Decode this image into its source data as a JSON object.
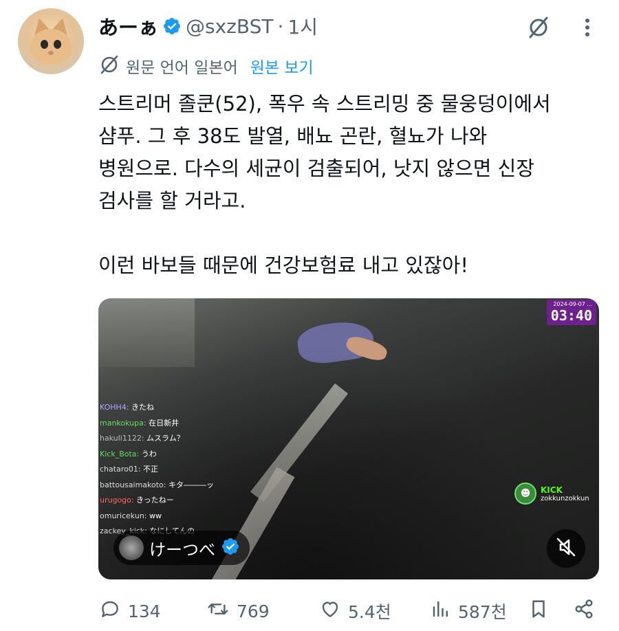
{
  "tweet": {
    "author": {
      "name": "あーぁ",
      "handle": "@sxzBST",
      "separator": "·",
      "time": "1시",
      "verified": true
    },
    "translation": {
      "label": "원문 언어 일본어",
      "show_original": "원본 보기"
    },
    "text_lines": [
      "스트리머 졸쿤(52), 폭우 속 스트리밍 중 물웅덩이에서",
      "샴푸. 그 후 38도 발열, 배뇨 곤란, 혈뇨가 나와",
      "병원으로. 다수의 세균이 검출되어, 낫지 않으면 신장",
      "검사를 할 거라고.",
      "",
      "이런 바보들 때문에 건강보험료 내고 있잖아!"
    ],
    "media": {
      "timestamp_date": "2024-09-07 ...",
      "timestamp": "03:40",
      "chat": [
        {
          "user": "KOHH4",
          "color": "#a9a9ff",
          "message": "きたね"
        },
        {
          "user": "mankokupa",
          "color": "#66dd66",
          "message": "在日新井"
        },
        {
          "user": "hakuli1122",
          "color": "#bbbbbb",
          "message": "ムスラム？"
        },
        {
          "user": "Kick_Bota",
          "color": "#66dd66",
          "message": "うわ"
        },
        {
          "user": "chataro01",
          "color": "#dddddd",
          "message": "不正"
        },
        {
          "user": "battousaimakoto",
          "color": "#dddddd",
          "message": "キタ―――ッ"
        },
        {
          "user": "urugogo",
          "color": "#ff6666",
          "message": "きったねー"
        },
        {
          "user": "omuricekun",
          "color": "#dddddd",
          "message": "ww"
        },
        {
          "user": "zackey_kick",
          "color": "#dddddd",
          "message": "なにしてんの"
        }
      ],
      "kick_brand": "KICK",
      "kick_user": "zokkunzokkun",
      "creator_name": "けーつべ"
    },
    "stats": {
      "replies": "134",
      "reposts": "769",
      "likes": "5.4천",
      "views": "587천"
    }
  },
  "colors": {
    "verified": "#1d9bf0",
    "link": "#1d9bf0",
    "muted_text": "#536471",
    "kick_green": "#53fc18"
  },
  "icons": [
    "verified-badge-icon",
    "grok-icon",
    "more-icon",
    "translate-globe-icon",
    "mute-icon",
    "reply-icon",
    "repost-icon",
    "like-icon",
    "views-icon",
    "bookmark-icon",
    "share-icon"
  ]
}
